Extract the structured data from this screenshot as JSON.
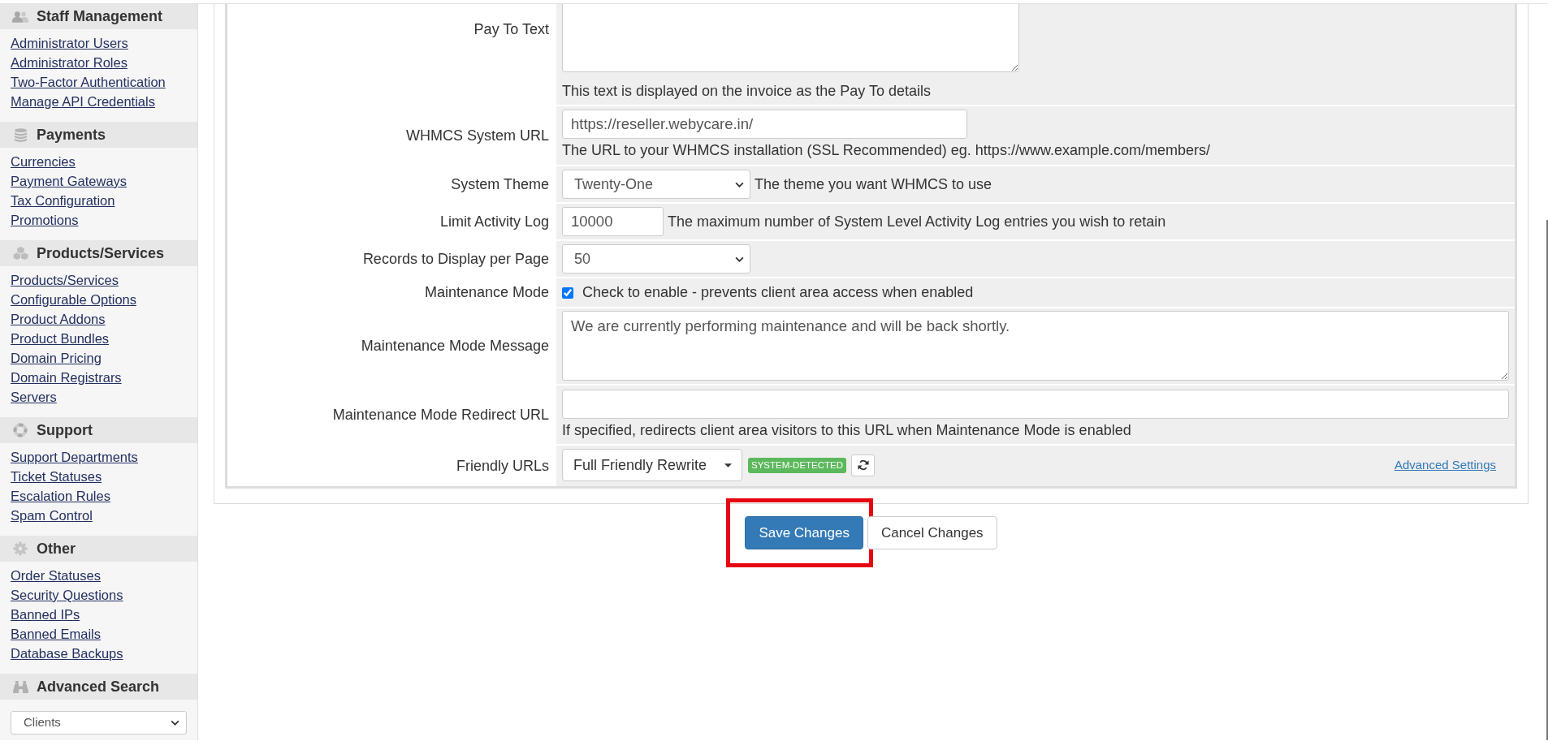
{
  "sidebar": {
    "sections": [
      {
        "title": "Staff Management",
        "links": [
          "Administrator Users",
          "Administrator Roles",
          "Two-Factor Authentication",
          "Manage API Credentials"
        ]
      },
      {
        "title": "Payments",
        "links": [
          "Currencies",
          "Payment Gateways",
          "Tax Configuration",
          "Promotions"
        ]
      },
      {
        "title": "Products/Services",
        "links": [
          "Products/Services",
          "Configurable Options",
          "Product Addons",
          "Product Bundles",
          "Domain Pricing",
          "Domain Registrars",
          "Servers"
        ]
      },
      {
        "title": "Support",
        "links": [
          "Support Departments",
          "Ticket Statuses",
          "Escalation Rules",
          "Spam Control"
        ]
      },
      {
        "title": "Other",
        "links": [
          "Order Statuses",
          "Security Questions",
          "Banned IPs",
          "Banned Emails",
          "Database Backups"
        ]
      }
    ],
    "advanced_search": {
      "title": "Advanced Search",
      "select_value": "Clients"
    }
  },
  "settings": {
    "rows": [
      {
        "label": "Pay To Text",
        "kind": "textarea",
        "help": "This text is displayed on the invoice as the Pay To details"
      },
      {
        "label": "WHMCS System URL",
        "kind": "input",
        "value": "https://reseller.webycare.in/",
        "help": "The URL to your WHMCS installation (SSL Recommended) eg. https://www.example.com/members/"
      },
      {
        "label": "System Theme",
        "kind": "select",
        "value": "Twenty-One",
        "note": "The theme you want WHMCS to use"
      },
      {
        "label": "Limit Activity Log",
        "kind": "input",
        "value": "10000",
        "note": "The maximum number of System Level Activity Log entries you wish to retain"
      },
      {
        "label": "Records to Display per Page",
        "kind": "select",
        "value": "50"
      },
      {
        "label": "Maintenance Mode",
        "kind": "checkbox",
        "checked": true,
        "note": "Check to enable - prevents client area access when enabled"
      },
      {
        "label": "Maintenance Mode Message",
        "kind": "textarea",
        "value": "We are currently performing maintenance and will be back shortly."
      },
      {
        "label": "Maintenance Mode Redirect URL",
        "kind": "input",
        "help": "If specified, redirects client area visitors to this URL when Maintenance Mode is enabled"
      },
      {
        "label": "Friendly URLs",
        "kind": "dropdown",
        "value": "Full Friendly Rewrite",
        "badge": "SYSTEM-DETECTED",
        "link": "Advanced Settings"
      }
    ]
  },
  "buttons": [
    {
      "label": "Save Changes",
      "kind": "primary",
      "highlighted": true
    },
    {
      "label": "Cancel Changes",
      "kind": "default",
      "highlighted": false
    }
  ]
}
